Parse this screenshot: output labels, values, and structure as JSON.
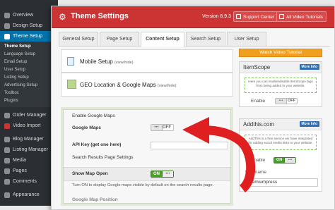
{
  "sidebar": {
    "items": [
      {
        "label": "Overview"
      },
      {
        "label": "Design Setup"
      },
      {
        "label": "Theme Setup"
      }
    ],
    "submenu": [
      "Theme Setup",
      "Language Setup",
      "Email Setup",
      "User Setup",
      "Listing Setup",
      "Advertising Setup",
      "Toolbox",
      "Plugins"
    ],
    "items_after": [
      {
        "label": "Order Manager"
      },
      {
        "label": "Video Import"
      },
      {
        "label": "Blog Manager"
      },
      {
        "label": "Listing Manager"
      },
      {
        "label": "Media"
      },
      {
        "label": "Pages"
      },
      {
        "label": "Comments"
      },
      {
        "label": "Appearance"
      }
    ]
  },
  "header": {
    "title": "Theme Settings",
    "version": "Version 8.9.3",
    "support_label": "Support Center",
    "videos_label": "All Video Tutorials"
  },
  "tabs": [
    "General Setup",
    "Page Setup",
    "Content Setup",
    "Search Setup",
    "User Setup"
  ],
  "active_tab": "Content Setup",
  "sections": {
    "mobile": {
      "title": "Mobile Setup",
      "toggle_hint": "(view/hide)"
    },
    "geo": {
      "title": "GEO Location & Google Maps",
      "toggle_hint": "(view/hide)"
    }
  },
  "maps_form": {
    "enable_heading": "Enable Google Maps",
    "google_maps_label": "Google Maps",
    "google_maps_state": "OFF",
    "api_key_label": "API Key",
    "api_key_link": "(get one here)",
    "search_heading": "Search Results Page Settings",
    "show_map_label": "Show Map Open",
    "show_map_state": "ON",
    "show_map_help": "Turn ON to display Google maps visible by default on the search results page.",
    "position_label": "Google Map Position"
  },
  "right": {
    "watch_video": "Watch Video Tutorial",
    "itemscope": {
      "title": "ItemScope",
      "more_info": "More Info",
      "note": "Here you can enable/disable ItemScope tags from being added to your website.",
      "enable_label": "Enable",
      "state": "OFF"
    },
    "addthis": {
      "title": "Addthis.com",
      "more_info": "More Info",
      "note": "AddThis is a free service we have integrated for adding social media links to your website.",
      "enable_label": "Enable",
      "state": "ON",
      "username_label": "Username",
      "username_value": "premiumpress"
    }
  },
  "colors": {
    "header_red": "#cc3333",
    "sidebar_dark": "#2b2e33",
    "active_blue": "#0073aa",
    "arrow_red": "#e02020",
    "toggle_green": "#4a9e2a",
    "video_orange": "#f0a020"
  }
}
